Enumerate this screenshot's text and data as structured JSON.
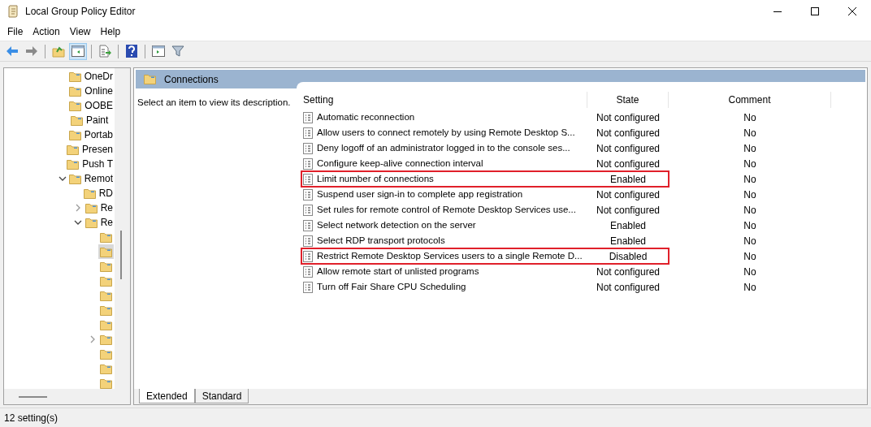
{
  "window": {
    "title": "Local Group Policy Editor"
  },
  "menu": [
    "File",
    "Action",
    "View",
    "Help"
  ],
  "toolbar": [
    {
      "kind": "back",
      "pressed": false
    },
    {
      "kind": "forward",
      "pressed": false
    },
    {
      "kind": "up",
      "pressed": false
    },
    {
      "kind": "pane",
      "pressed": true
    },
    {
      "kind": "export",
      "pressed": false
    },
    {
      "kind": "help",
      "pressed": false
    },
    {
      "kind": "pane2",
      "pressed": false
    },
    {
      "kind": "filter",
      "pressed": false
    }
  ],
  "tree": [
    {
      "label": "OneDr",
      "selected": false
    },
    {
      "label": "Online",
      "selected": false
    },
    {
      "label": "OOBE",
      "selected": false
    },
    {
      "label": "Paint",
      "selected": false
    },
    {
      "label": "Portab",
      "selected": false
    },
    {
      "label": "Presen",
      "selected": false
    },
    {
      "label": "Push T",
      "selected": false
    },
    {
      "label": "Remot",
      "selected": false,
      "expanded": true,
      "children": [
        {
          "label": "RD",
          "selected": false
        },
        {
          "label": "Re",
          "selected": false,
          "expanded": false
        },
        {
          "label": "Re",
          "selected": false,
          "expanded": true,
          "children": [
            {
              "selected": false
            },
            {
              "selected": true
            },
            {
              "selected": false
            },
            {
              "selected": false
            },
            {
              "selected": false
            },
            {
              "selected": false
            },
            {
              "selected": false
            },
            {
              "selected": false,
              "expanded": false
            },
            {
              "selected": false
            },
            {
              "selected": false
            },
            {
              "selected": false
            }
          ]
        }
      ]
    }
  ],
  "header": {
    "title": "Connections"
  },
  "description": "Select an item to view its description.",
  "table": {
    "columns": [
      "Setting",
      "State",
      "Comment"
    ],
    "rows": [
      {
        "setting": "Automatic reconnection",
        "state": "Not configured",
        "comment": "No",
        "highlighted": false
      },
      {
        "setting": "Allow users to connect remotely by using Remote Desktop S...",
        "state": "Not configured",
        "comment": "No",
        "highlighted": false
      },
      {
        "setting": "Deny logoff of an administrator logged in to the console ses...",
        "state": "Not configured",
        "comment": "No",
        "highlighted": false
      },
      {
        "setting": "Configure keep-alive connection interval",
        "state": "Not configured",
        "comment": "No",
        "highlighted": false
      },
      {
        "setting": "Limit number of connections",
        "state": "Enabled",
        "comment": "No",
        "highlighted": true
      },
      {
        "setting": "Suspend user sign-in to complete app registration",
        "state": "Not configured",
        "comment": "No",
        "highlighted": false
      },
      {
        "setting": "Set rules for remote control of Remote Desktop Services use...",
        "state": "Not configured",
        "comment": "No",
        "highlighted": false
      },
      {
        "setting": "Select network detection on the server",
        "state": "Enabled",
        "comment": "No",
        "highlighted": false
      },
      {
        "setting": "Select RDP transport protocols",
        "state": "Enabled",
        "comment": "No",
        "highlighted": false
      },
      {
        "setting": "Restrict Remote Desktop Services users to a single Remote D...",
        "state": "Disabled",
        "comment": "No",
        "highlighted": true
      },
      {
        "setting": "Allow remote start of unlisted programs",
        "state": "Not configured",
        "comment": "No",
        "highlighted": false
      },
      {
        "setting": "Turn off Fair Share CPU Scheduling",
        "state": "Not configured",
        "comment": "No",
        "highlighted": false
      }
    ]
  },
  "tabs": [
    {
      "label": "Extended",
      "selected": true
    },
    {
      "label": "Standard",
      "selected": false
    }
  ],
  "status_bar": "12 setting(s)"
}
